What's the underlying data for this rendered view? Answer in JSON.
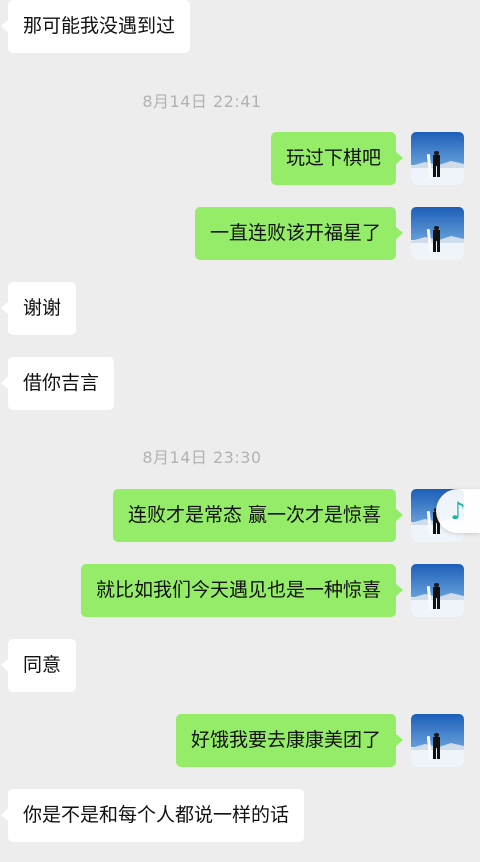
{
  "messages": [
    {
      "type": "text",
      "dir": "in",
      "text": "那可能我没遇到过"
    },
    {
      "type": "time",
      "text": "8月14日 22:41"
    },
    {
      "type": "text",
      "dir": "out",
      "text": "玩过下棋吧"
    },
    {
      "type": "text",
      "dir": "out",
      "text": "一直连败该开福星了"
    },
    {
      "type": "text",
      "dir": "in",
      "text": "谢谢"
    },
    {
      "type": "text",
      "dir": "in",
      "text": "借你吉言"
    },
    {
      "type": "time",
      "text": "8月14日 23:30"
    },
    {
      "type": "text",
      "dir": "out",
      "text": "连败才是常态 赢一次才是惊喜"
    },
    {
      "type": "text",
      "dir": "out",
      "text": "就比如我们今天遇见也是一种惊喜"
    },
    {
      "type": "text",
      "dir": "in",
      "text": "同意"
    },
    {
      "type": "text",
      "dir": "out",
      "text": "好饿我要去康康美团了"
    },
    {
      "type": "text",
      "dir": "in",
      "text": "你是不是和每个人都说一样的话"
    }
  ],
  "music_float": {
    "icon": "music-note-icon",
    "glyph": "♪"
  },
  "colors": {
    "background": "#ededed",
    "incoming": "#ffffff",
    "outgoing": "#95ec69",
    "timestamp": "#b2b2b2"
  }
}
